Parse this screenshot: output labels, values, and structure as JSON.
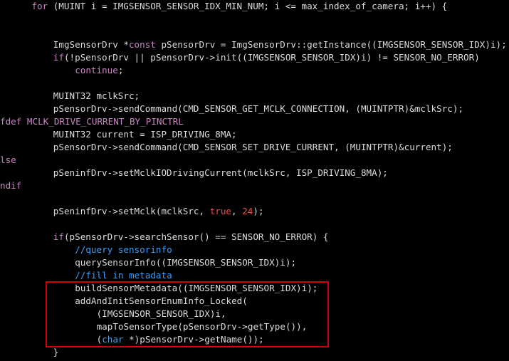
{
  "lines": [
    {
      "id": "l01",
      "indent": 4,
      "tokens": [
        {
          "t": "for",
          "c": "kw"
        },
        {
          "t": " (MUINT i = IMGSENSOR_SENSOR_IDX_MIN_NUM; i <= max_index_of_camera; i++) {",
          "c": "text"
        }
      ]
    },
    {
      "id": "l02",
      "indent": 0,
      "tokens": []
    },
    {
      "id": "l03",
      "indent": 0,
      "tokens": []
    },
    {
      "id": "l04",
      "indent": 8,
      "tokens": [
        {
          "t": "ImgSensorDrv *",
          "c": "text"
        },
        {
          "t": "const",
          "c": "kw"
        },
        {
          "t": " pSensorDrv = ImgSensorDrv::getInstance((IMGSENSOR_SENSOR_IDX)i);",
          "c": "text"
        }
      ]
    },
    {
      "id": "l05",
      "indent": 8,
      "tokens": [
        {
          "t": "if",
          "c": "kw"
        },
        {
          "t": "(!pSensorDrv || pSensorDrv->init((IMGSENSOR_SENSOR_IDX)i) != SENSOR_NO_ERROR)",
          "c": "text"
        }
      ]
    },
    {
      "id": "l06",
      "indent": 12,
      "tokens": [
        {
          "t": "continue",
          "c": "kw"
        },
        {
          "t": ";",
          "c": "text"
        }
      ]
    },
    {
      "id": "l07",
      "indent": 0,
      "tokens": []
    },
    {
      "id": "l08",
      "indent": 8,
      "tokens": [
        {
          "t": "MUINT32 mclkSrc;",
          "c": "text"
        }
      ]
    },
    {
      "id": "l09",
      "indent": 8,
      "tokens": [
        {
          "t": "pSensorDrv->sendCommand(CMD_SENSOR_GET_MCLK_CONNECTION, (MUINTPTR)&mclkSrc);",
          "c": "text"
        }
      ]
    },
    {
      "id": "l10",
      "indent": -1,
      "tokens": [
        {
          "t": "fdef MCLK_DRIVE_CURRENT_BY_PINCTRL",
          "c": "macro"
        }
      ]
    },
    {
      "id": "l11",
      "indent": 8,
      "tokens": [
        {
          "t": "MUINT32 current = ISP_DRIVING_8MA;",
          "c": "text"
        }
      ]
    },
    {
      "id": "l12",
      "indent": 8,
      "tokens": [
        {
          "t": "pSensorDrv->sendCommand(CMD_SENSOR_SET_DRIVE_CURRENT, (MUINTPTR)&current);",
          "c": "text"
        }
      ]
    },
    {
      "id": "l13",
      "indent": -1,
      "tokens": [
        {
          "t": "lse",
          "c": "macro"
        }
      ]
    },
    {
      "id": "l14",
      "indent": 8,
      "tokens": [
        {
          "t": "pSeninfDrv->setMclkIODrivingCurrent(mclkSrc, ISP_DRIVING_8MA);",
          "c": "text"
        }
      ]
    },
    {
      "id": "l15",
      "indent": -1,
      "tokens": [
        {
          "t": "ndif",
          "c": "macro"
        }
      ]
    },
    {
      "id": "l16",
      "indent": 0,
      "tokens": []
    },
    {
      "id": "l17",
      "indent": 8,
      "tokens": [
        {
          "t": "pSeninfDrv->setMclk(mclkSrc, ",
          "c": "text"
        },
        {
          "t": "true",
          "c": "bool"
        },
        {
          "t": ", ",
          "c": "text"
        },
        {
          "t": "24",
          "c": "num"
        },
        {
          "t": ");",
          "c": "text"
        }
      ]
    },
    {
      "id": "l18",
      "indent": 0,
      "tokens": []
    },
    {
      "id": "l19",
      "indent": 8,
      "tokens": [
        {
          "t": "if",
          "c": "kw"
        },
        {
          "t": "(pSensorDrv->searchSensor() == SENSOR_NO_ERROR) {",
          "c": "text"
        }
      ]
    },
    {
      "id": "l20",
      "indent": 12,
      "tokens": [
        {
          "t": "//query sensorinfo",
          "c": "cmt"
        }
      ]
    },
    {
      "id": "l21",
      "indent": 12,
      "tokens": [
        {
          "t": "querySensorInfo((IMGSENSOR_SENSOR_IDX)i);",
          "c": "text"
        }
      ]
    },
    {
      "id": "l22",
      "indent": 12,
      "tokens": [
        {
          "t": "//fill in metadata",
          "c": "cmt"
        }
      ]
    },
    {
      "id": "l23",
      "indent": 12,
      "tokens": [
        {
          "t": "buildSensorMetadata((IMGSENSOR_SENSOR_IDX)i);",
          "c": "text"
        }
      ]
    },
    {
      "id": "l24",
      "indent": 12,
      "tokens": [
        {
          "t": "addAndInitSensorEnumInfo_Locked(",
          "c": "text"
        }
      ]
    },
    {
      "id": "l25",
      "indent": 16,
      "tokens": [
        {
          "t": "(IMGSENSOR_SENSOR_IDX)i,",
          "c": "text"
        }
      ]
    },
    {
      "id": "l26",
      "indent": 16,
      "tokens": [
        {
          "t": "mapToSensorType(pSensorDrv->getType()),",
          "c": "text"
        }
      ]
    },
    {
      "id": "l27",
      "indent": 16,
      "tokens": [
        {
          "t": "(",
          "c": "text"
        },
        {
          "t": "char",
          "c": "kwb"
        },
        {
          "t": " *)pSensorDrv->getName());",
          "c": "text"
        }
      ]
    },
    {
      "id": "l28",
      "indent": 8,
      "tokens": [
        {
          "t": "}",
          "c": "text"
        }
      ]
    }
  ],
  "colors": {
    "background": "#000000",
    "text": "#dcdcdc",
    "keyword": "#c586c0",
    "type_keyword": "#569cd6",
    "literal": "#f44747",
    "comment": "#3b9cf7",
    "highlight_border": "#d00000"
  }
}
